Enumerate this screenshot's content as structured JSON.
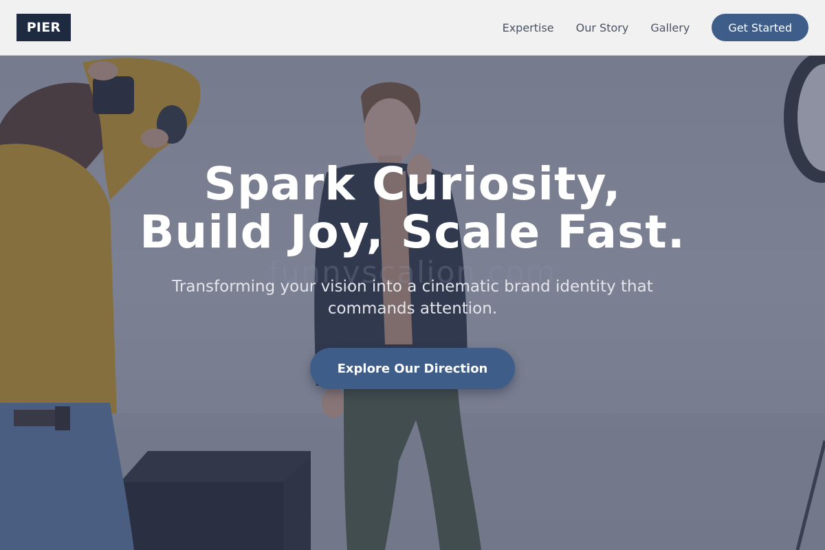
{
  "brand": {
    "logo_text": "PIER"
  },
  "nav": {
    "links": [
      {
        "label": "Expertise"
      },
      {
        "label": "Our Story"
      },
      {
        "label": "Gallery"
      }
    ],
    "cta_label": "Get Started"
  },
  "hero": {
    "title_line1": "Spark Curiosity,",
    "title_line2": "Build Joy, Scale Fast.",
    "subtitle": "Transforming your vision into a cinematic brand identity that commands attention.",
    "cta_label": "Explore Our Direction",
    "watermark": "funnyscalion.com",
    "image": {
      "semantic": "photo-shoot-studio",
      "description_icon": "photographer-and-model-photo"
    }
  },
  "colors": {
    "brand_dark": "#1e2a40",
    "accent": "#3f5d89",
    "header_bg": "#f1f1f1",
    "nav_text": "#4a5263",
    "hero_overlay": "#3a425c"
  }
}
